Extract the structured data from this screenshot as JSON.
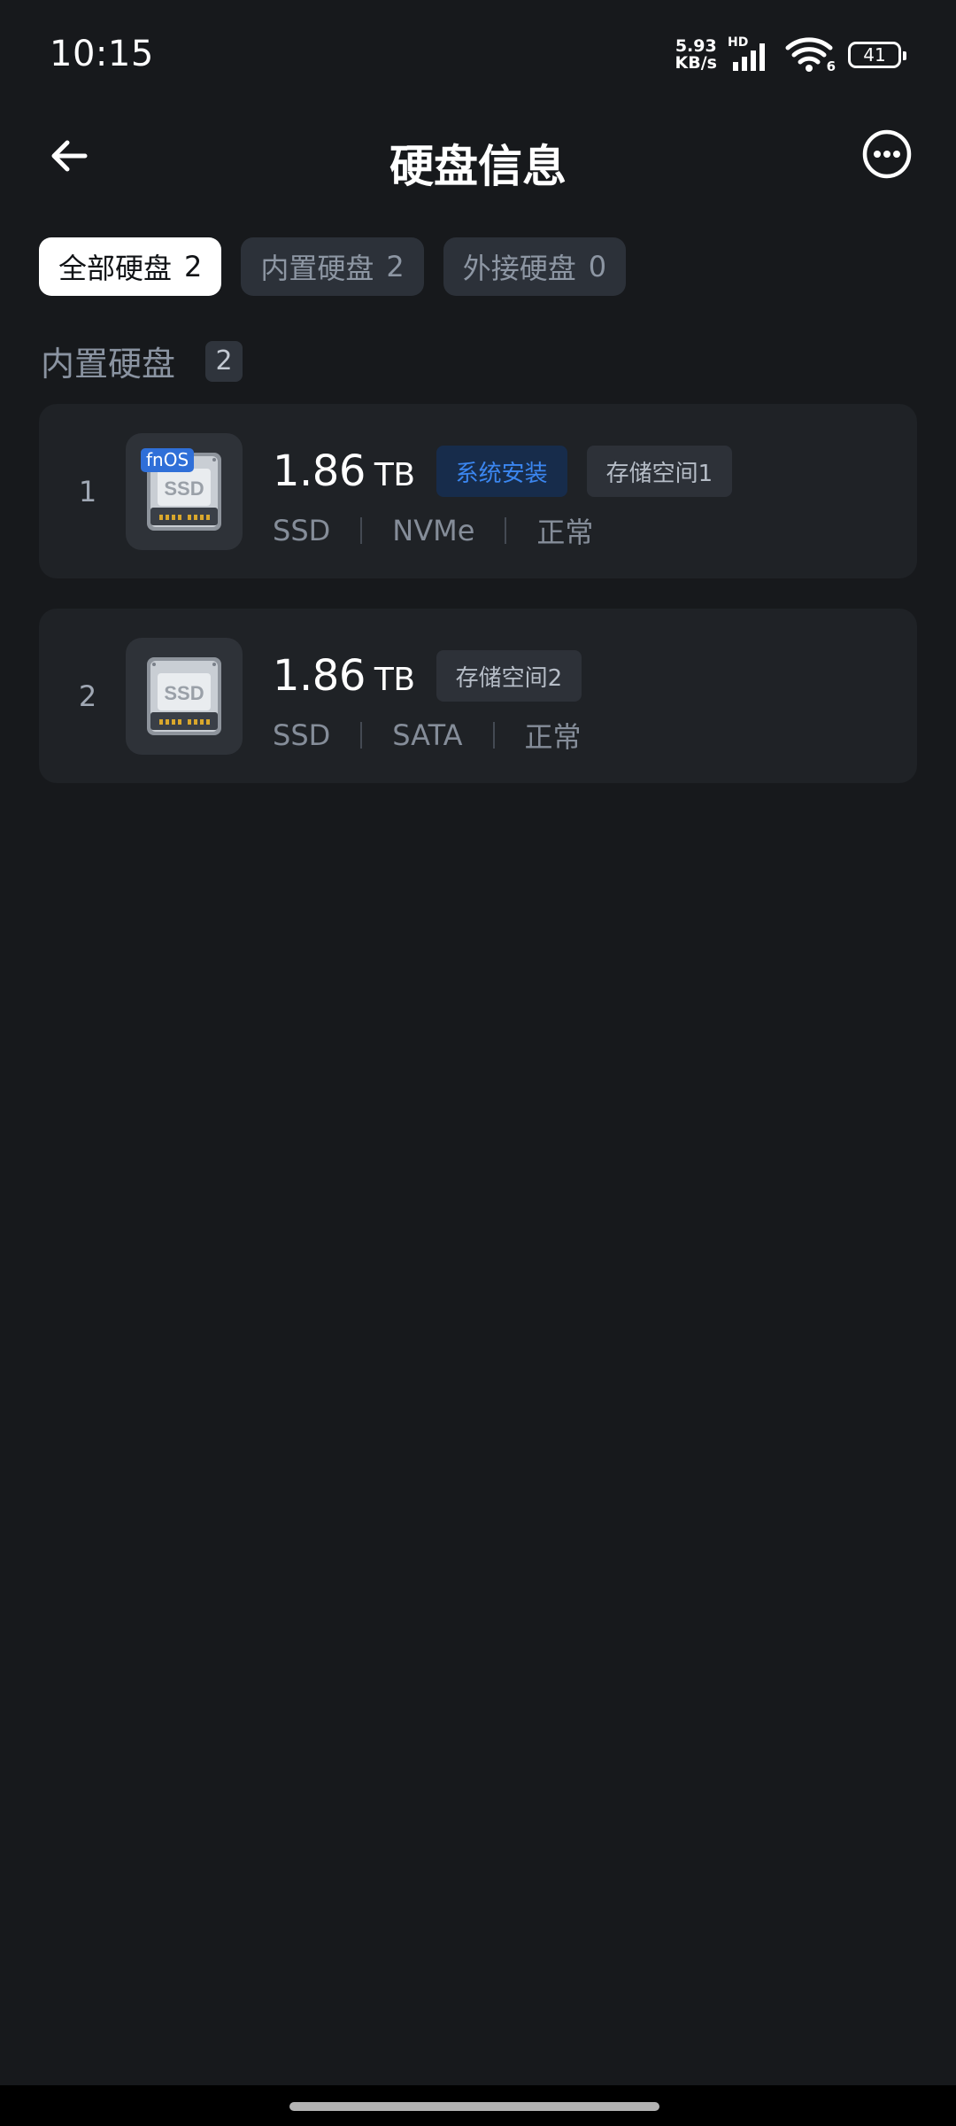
{
  "status_bar": {
    "time": "10:15",
    "net_speed_value": "5.93",
    "net_speed_unit": "KB/s",
    "network_type": "HD",
    "wifi_badge": "6",
    "battery": "41"
  },
  "header": {
    "title": "硬盘信息",
    "back_icon": "arrow-left-icon",
    "more_icon": "more-horizontal-icon"
  },
  "tabs": [
    {
      "label": "全部硬盘",
      "count": "2",
      "active": true
    },
    {
      "label": "内置硬盘",
      "count": "2",
      "active": false
    },
    {
      "label": "外接硬盘",
      "count": "0",
      "active": false
    }
  ],
  "section": {
    "title": "内置硬盘",
    "count": "2"
  },
  "disks": [
    {
      "index": "1",
      "badge": "fnOS",
      "icon_label": "SSD",
      "size": "1.86",
      "unit": "TB",
      "tags": [
        "系统安装",
        "存储空间1"
      ],
      "type": "SSD",
      "interface": "NVMe",
      "status": "正常"
    },
    {
      "index": "2",
      "icon_label": "SSD",
      "size": "1.86",
      "unit": "TB",
      "tags": [
        "存储空间2"
      ],
      "type": "SSD",
      "interface": "SATA",
      "status": "正常"
    }
  ],
  "colors": {
    "background": "#17191c",
    "card": "#1f2226",
    "accent": "#3b86f0"
  }
}
